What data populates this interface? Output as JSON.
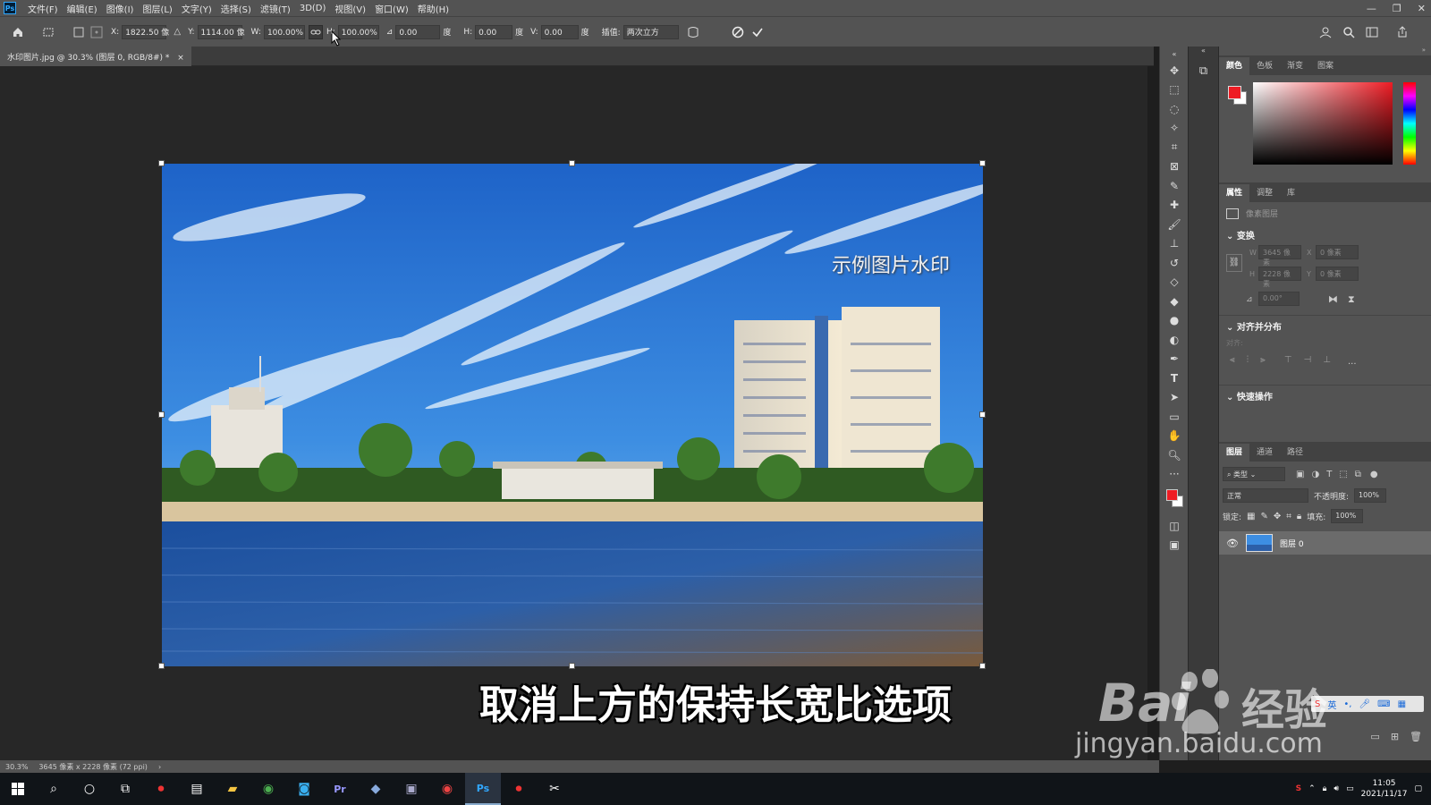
{
  "app": {
    "logo": "Ps",
    "title": "Photoshop"
  },
  "menu": [
    "文件(F)",
    "编辑(E)",
    "图像(I)",
    "图层(L)",
    "文字(Y)",
    "选择(S)",
    "滤镜(T)",
    "3D(D)",
    "视图(V)",
    "窗口(W)",
    "帮助(H)"
  ],
  "window_controls": [
    "—",
    "❐",
    "✕"
  ],
  "options": {
    "x_label": "X:",
    "x_value": "1822.50 像",
    "y_label": "Y:",
    "y_value": "1114.00 像",
    "w_label": "W:",
    "w_value": "100.00%",
    "h_label": "H:",
    "h_value": "100.00%",
    "angle_value": "0.00",
    "angle_unit": "度",
    "hskew_label": "H:",
    "hskew_value": "0.00",
    "hskew_unit": "度",
    "vskew_label": "V:",
    "vskew_value": "0.00",
    "vskew_unit": "度",
    "interp_label": "插值:",
    "interp_value": "两次立方"
  },
  "document_tab": {
    "title": "水印图片.jpg @ 30.3% (图层 0, RGB/8#) *",
    "close": "×"
  },
  "image": {
    "watermark": "示例图片水印"
  },
  "status": {
    "zoom": "30.3%",
    "info": "3645 像素 x 2228 像素 (72 ppi)",
    "arrow": "›"
  },
  "color_panel": {
    "tabs": [
      "颜色",
      "色板",
      "渐变",
      "图案"
    ],
    "fg": "#ee1c24",
    "bg": "#ffffff"
  },
  "properties_panel": {
    "tabs": [
      "属性",
      "调整",
      "库"
    ],
    "layer_type": "像素图层",
    "transform_title": "变换",
    "w_value": "3645 像素",
    "x_value": "0 像素",
    "h_value": "2228 像素",
    "y_value": "0 像素",
    "angle_value": "0.00°",
    "align_title": "对齐并分布",
    "align_label": "对齐:",
    "more": "···",
    "quick_title": "快速操作"
  },
  "layers_panel": {
    "tabs": [
      "图层",
      "通道",
      "路径"
    ],
    "filter_label": "类型",
    "blend_mode": "正常",
    "opacity_label": "不透明度:",
    "opacity_value": "100%",
    "lock_label": "锁定:",
    "fill_label": "填充:",
    "fill_value": "100%",
    "layer_name": "图层 0"
  },
  "subtitle": "取消上方的保持长宽比选项",
  "watermark_site": {
    "brand": "Bai",
    "brand_cn": "经验",
    "url": "jingyan.baidu.com"
  },
  "taskbar": {
    "time": "11:05",
    "date": "2021/11/17",
    "pr": "Pr",
    "ps": "Ps"
  }
}
